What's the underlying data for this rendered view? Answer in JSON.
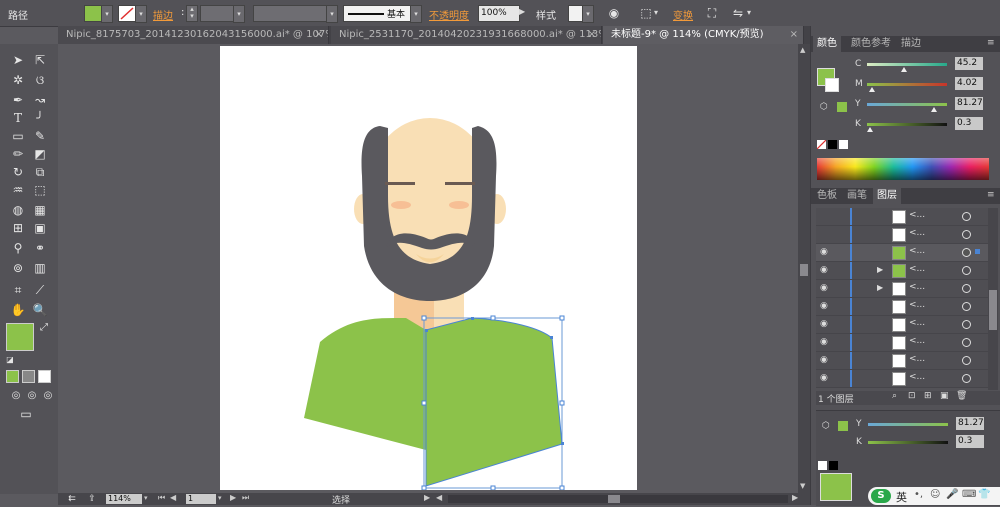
{
  "control_bar": {
    "selection_label": "路径",
    "fill_color": "#8cc24a",
    "stroke_label": "描边",
    "brush_label": "基本",
    "opacity_label": "不透明度",
    "opacity_value": "100%",
    "style_label": "样式",
    "transform_label": "变换"
  },
  "tabs": [
    {
      "label": "Nipic_8175703_20141230162043156000.ai* @ 107% ...",
      "close": "×"
    },
    {
      "label": "Nipic_2531170_20140420231931668000.ai* @ 113% ...",
      "close": "×"
    },
    {
      "label": "未标题-9* @ 114% (CMYK/预览)",
      "close": "×"
    }
  ],
  "color_panel": {
    "tabs": [
      "颜色",
      "颜色参考",
      "描边"
    ],
    "channels": [
      {
        "name": "C",
        "value": "45.2"
      },
      {
        "name": "M",
        "value": "4.02"
      },
      {
        "name": "Y",
        "value": "81.27"
      },
      {
        "name": "K",
        "value": "0.3"
      }
    ]
  },
  "layers_panel": {
    "tabs": [
      "色板",
      "画笔",
      "图层"
    ],
    "row_label": "<...",
    "footer": "1 个图层"
  },
  "second_color": {
    "channels": [
      {
        "name": "Y",
        "value": "81.27"
      },
      {
        "name": "K",
        "value": "0.3"
      }
    ]
  },
  "status_bar": {
    "zoom": "114%",
    "page": "1",
    "mode": "选择"
  },
  "taskbar": {
    "ime_label": "英"
  },
  "colors": {
    "green": "#8cc24a",
    "skin": "#f9dfb5",
    "hair": "#5a595e",
    "accent_orange": "#f29a3a"
  }
}
